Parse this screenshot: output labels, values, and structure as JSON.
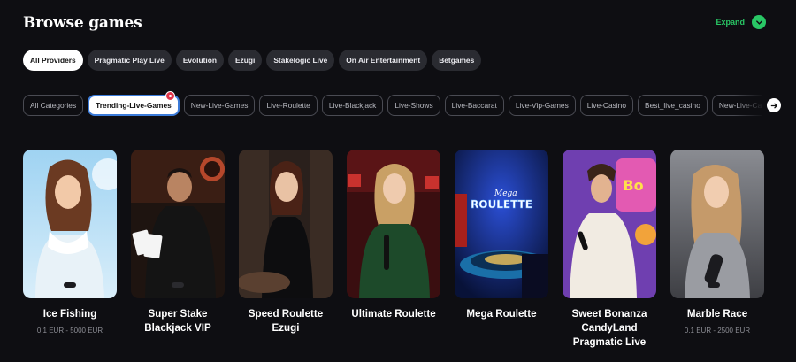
{
  "header": {
    "title": "Browse games",
    "expand_label": "Expand"
  },
  "providers": [
    {
      "label": "All Providers",
      "active": true
    },
    {
      "label": "Pragmatic Play Live"
    },
    {
      "label": "Evolution"
    },
    {
      "label": "Ezugi"
    },
    {
      "label": "Stakelogic Live"
    },
    {
      "label": "On Air Entertainment"
    },
    {
      "label": "Betgames"
    }
  ],
  "categories": [
    {
      "label": "All Categories"
    },
    {
      "label": "Trending-Live-Games",
      "active": true
    },
    {
      "label": "New-Live-Games"
    },
    {
      "label": "Live-Roulette"
    },
    {
      "label": "Live-Blackjack"
    },
    {
      "label": "Live-Shows"
    },
    {
      "label": "Live-Baccarat"
    },
    {
      "label": "Live-Vip-Games"
    },
    {
      "label": "Live-Casino"
    },
    {
      "label": "Best_live_casino"
    },
    {
      "label": "New-Live-Casino"
    }
  ],
  "games": [
    {
      "title": "Ice Fishing",
      "limits": "0.1 EUR - 5000 EUR"
    },
    {
      "title": "Super Stake Blackjack VIP",
      "limits": ""
    },
    {
      "title": "Speed Roulette Ezugi",
      "limits": ""
    },
    {
      "title": "Ultimate Roulette",
      "limits": ""
    },
    {
      "title": "Mega Roulette",
      "limits": ""
    },
    {
      "title": "Sweet Bonanza CandyLand Pragmatic Live",
      "limits": ""
    },
    {
      "title": "Marble Race",
      "limits": "0.1 EUR - 2500 EUR"
    }
  ],
  "thumb_text": {
    "mega_roulette": "ROULETTE",
    "mega_roulette_small": "Mega",
    "bonanza_sign": "Bo"
  },
  "colors": {
    "accent": "#29c765",
    "background": "#0e0e12",
    "pill": "#2a2b31",
    "badge": "#e2364c"
  },
  "icons": {
    "expand": "chevron-down-icon",
    "next": "arrow-right-icon"
  }
}
